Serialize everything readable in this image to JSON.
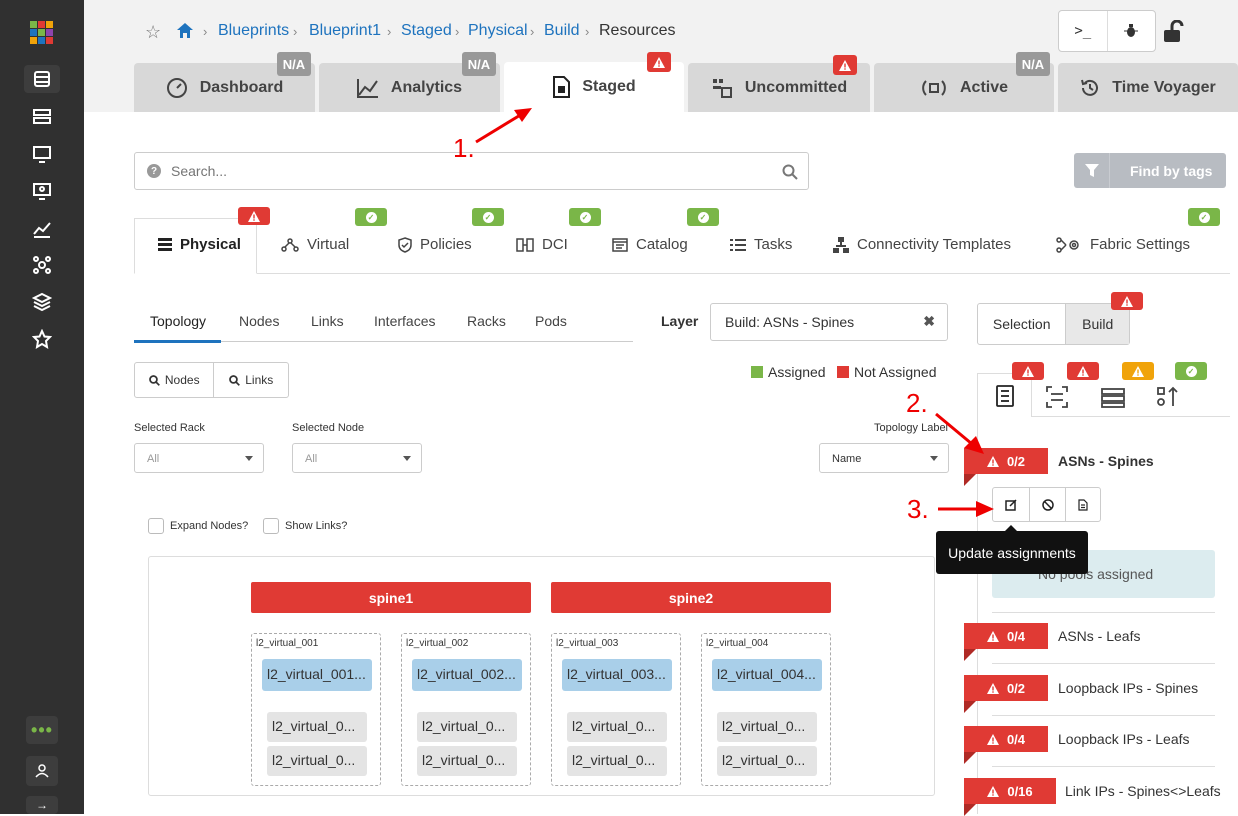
{
  "breadcrumb": [
    "Blueprints",
    "Blueprint1",
    "Staged",
    "Physical",
    "Build",
    "Resources"
  ],
  "main_tabs": [
    {
      "label": "Dashboard",
      "badge": "N/A"
    },
    {
      "label": "Analytics",
      "badge": "N/A"
    },
    {
      "label": "Staged",
      "badge": "warning"
    },
    {
      "label": "Uncommitted",
      "badge": "warning"
    },
    {
      "label": "Active",
      "badge": "N/A"
    },
    {
      "label": "Time Voyager"
    }
  ],
  "search": {
    "placeholder": "Search..."
  },
  "find_by_tags": "Find by tags",
  "staged_tabs": [
    {
      "label": "Physical",
      "status": "warning"
    },
    {
      "label": "Virtual",
      "status": "ok"
    },
    {
      "label": "Policies",
      "status": "ok"
    },
    {
      "label": "DCI",
      "status": "ok"
    },
    {
      "label": "Catalog",
      "status": "ok"
    },
    {
      "label": "Tasks"
    },
    {
      "label": "Connectivity Templates"
    },
    {
      "label": "Fabric Settings",
      "status": "ok"
    }
  ],
  "sub_tabs": [
    "Topology",
    "Nodes",
    "Links",
    "Interfaces",
    "Racks",
    "Pods"
  ],
  "layer": {
    "label": "Layer",
    "value": "Build: ASNs - Spines"
  },
  "legend": {
    "assigned": "Assigned",
    "not_assigned": "Not Assigned"
  },
  "toggles": {
    "nodes": "Nodes",
    "links": "Links"
  },
  "filters": {
    "rack_label": "Selected Rack",
    "rack_value": "All",
    "node_label": "Selected Node",
    "node_value": "All",
    "topology_label": "Topology Label",
    "topology_value": "Name"
  },
  "checkboxes": {
    "expand": "Expand Nodes?",
    "show_links": "Show Links?"
  },
  "topology": {
    "spines": [
      "spine1",
      "spine2"
    ],
    "racks": [
      {
        "name": "l2_virtual_001",
        "leaf": "l2_virtual_001...",
        "generics": [
          "l2_virtual_0...",
          "l2_virtual_0..."
        ]
      },
      {
        "name": "l2_virtual_002",
        "leaf": "l2_virtual_002...",
        "generics": [
          "l2_virtual_0...",
          "l2_virtual_0..."
        ]
      },
      {
        "name": "l2_virtual_003",
        "leaf": "l2_virtual_003...",
        "generics": [
          "l2_virtual_0...",
          "l2_virtual_0..."
        ]
      },
      {
        "name": "l2_virtual_004",
        "leaf": "l2_virtual_004...",
        "generics": [
          "l2_virtual_0...",
          "l2_virtual_0..."
        ]
      }
    ]
  },
  "right_panel": {
    "selection": "Selection",
    "build": "Build",
    "resources": [
      {
        "count": "0/2",
        "label": "ASNs - Spines"
      },
      {
        "count": "0/4",
        "label": "ASNs - Leafs"
      },
      {
        "count": "0/2",
        "label": "Loopback IPs - Spines"
      },
      {
        "count": "0/4",
        "label": "Loopback IPs - Leafs"
      },
      {
        "count": "0/16",
        "label": "Link IPs - Spines<>Leafs"
      }
    ],
    "no_pools": "No pools assigned",
    "tooltip": "Update assignments"
  },
  "annotations": [
    "1.",
    "2.",
    "3."
  ],
  "colors": {
    "brand_blue": "#1e73be",
    "danger": "#e03a34",
    "success": "#7ab648",
    "warning": "#f0a30a",
    "sidebar": "#303030"
  }
}
